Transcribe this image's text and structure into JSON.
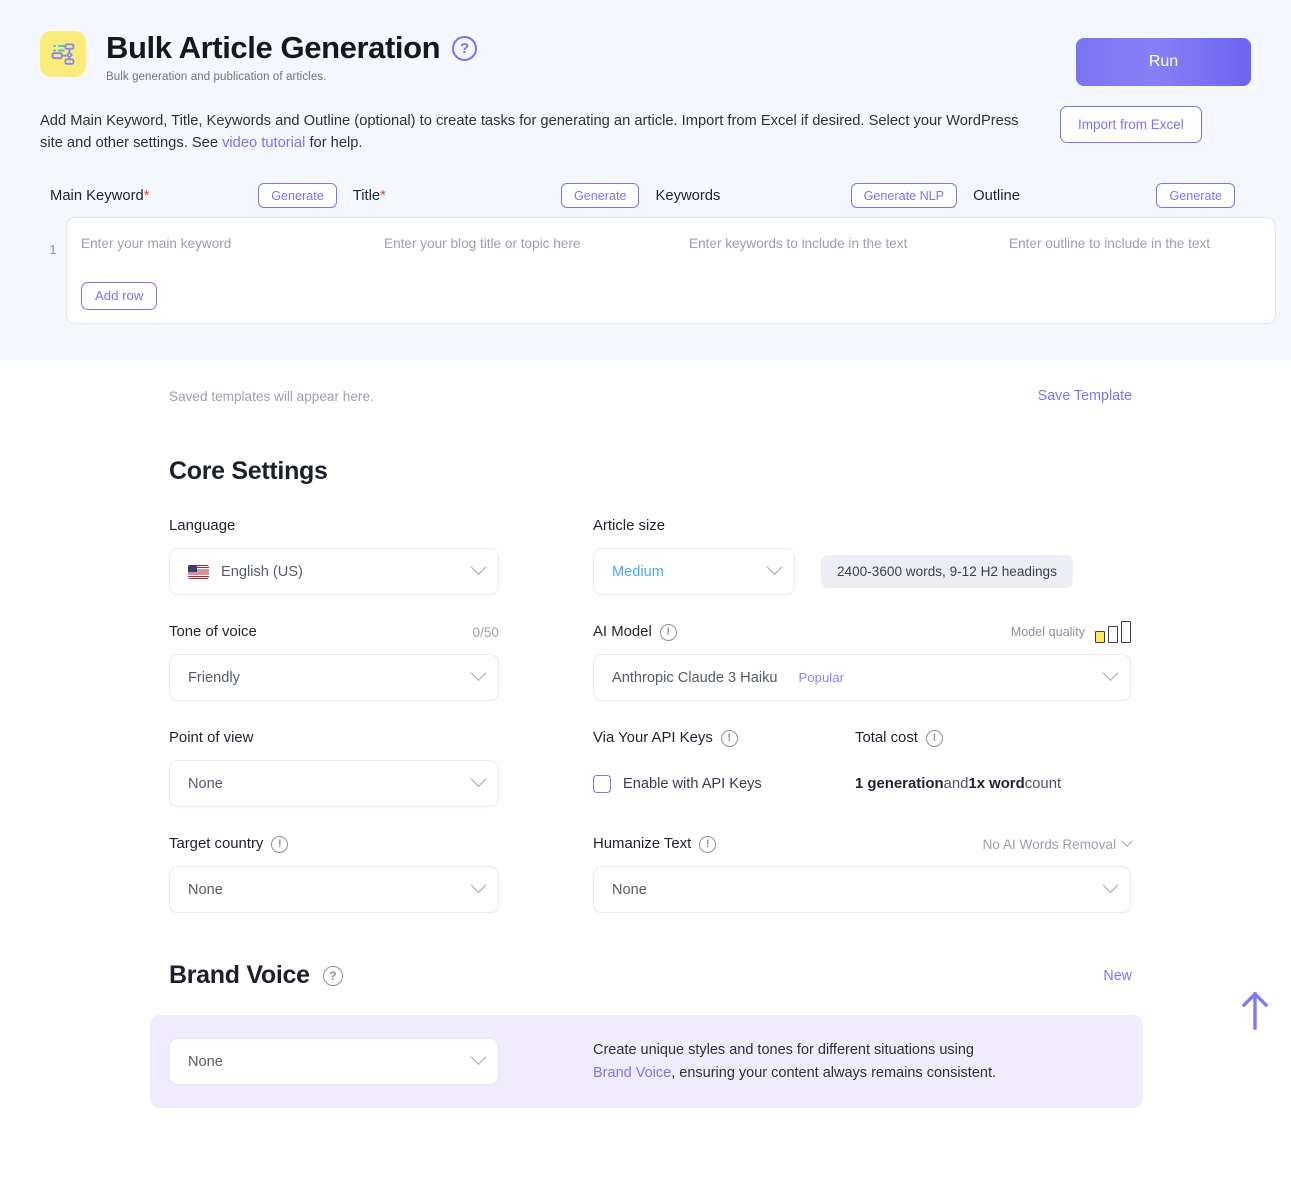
{
  "header": {
    "icon": "sitemap-icon",
    "title": "Bulk Article Generation",
    "help_icon": "question-mark-icon",
    "subtitle": "Bulk generation and publication of articles.",
    "run_label": "Run"
  },
  "description": {
    "part1": "Add Main Keyword, Title, Keywords and Outline (optional) to create tasks for generating an article. Import from Excel if desired. Select your WordPress site and other settings. See ",
    "link": "video tutorial",
    "part2": " for help.",
    "import_label": "Import from Excel"
  },
  "table": {
    "columns": [
      {
        "label": "Main Keyword",
        "required": "*",
        "action": "Generate",
        "placeholder": "Enter your main keyword"
      },
      {
        "label": "Title",
        "required": "*",
        "action": "Generate",
        "placeholder": "Enter your blog title or topic here"
      },
      {
        "label": "Keywords",
        "required": "",
        "action": "Generate NLP",
        "placeholder": "Enter keywords to include in the text"
      },
      {
        "label": "Outline",
        "required": "",
        "action": "Generate",
        "placeholder": "Enter outline to include in the text"
      }
    ],
    "row_number": "1",
    "add_row_label": "Add row"
  },
  "templates": {
    "note": "Saved templates will appear here.",
    "save_label": "Save Template"
  },
  "core": {
    "title": "Core Settings",
    "language": {
      "label": "Language",
      "value": "English (US)",
      "flag": "us-flag-icon"
    },
    "article_size": {
      "label": "Article size",
      "value": "Medium",
      "hint": "2400-3600 words, 9-12 H2 headings"
    },
    "tone": {
      "label": "Tone of voice",
      "counter": "0/50",
      "value": "Friendly"
    },
    "ai_model": {
      "label": "AI Model",
      "info_icon": "info-icon",
      "quality_label": "Model quality",
      "quality_level": 1,
      "value": "Anthropic Claude 3 Haiku",
      "tag": "Popular"
    },
    "point_of_view": {
      "label": "Point of view",
      "value": "None"
    },
    "api_keys": {
      "label": "Via Your API Keys",
      "info_icon": "info-icon",
      "checkbox_label": "Enable with API Keys",
      "checked": false
    },
    "total_cost": {
      "label": "Total cost",
      "info_icon": "info-icon",
      "value_bold1": "1 generation",
      "value_mid": " and ",
      "value_bold2": "1x word",
      "value_end": " count"
    },
    "target_country": {
      "label": "Target country",
      "info_icon": "info-icon",
      "value": "None"
    },
    "humanize": {
      "label": "Humanize Text",
      "info_icon": "info-icon",
      "right_value": "No AI Words Removal",
      "value": "None"
    }
  },
  "brand_voice": {
    "title": "Brand Voice",
    "help_icon": "question-mark-icon",
    "new_label": "New",
    "value": "None",
    "desc_part1": "Create unique styles and tones for different situations using ",
    "desc_link": "Brand Voice",
    "desc_part2": ", ensuring your content always remains consistent."
  },
  "scroll_top": {
    "icon": "arrow-up-icon"
  },
  "colors": {
    "accent": "#7b74f1",
    "panel_bg": "#f4f8fc",
    "brand_voice_bg": "#f0ebfd",
    "icon_yellow": "#fbeb7a",
    "blue_value": "#4aa8f0"
  }
}
